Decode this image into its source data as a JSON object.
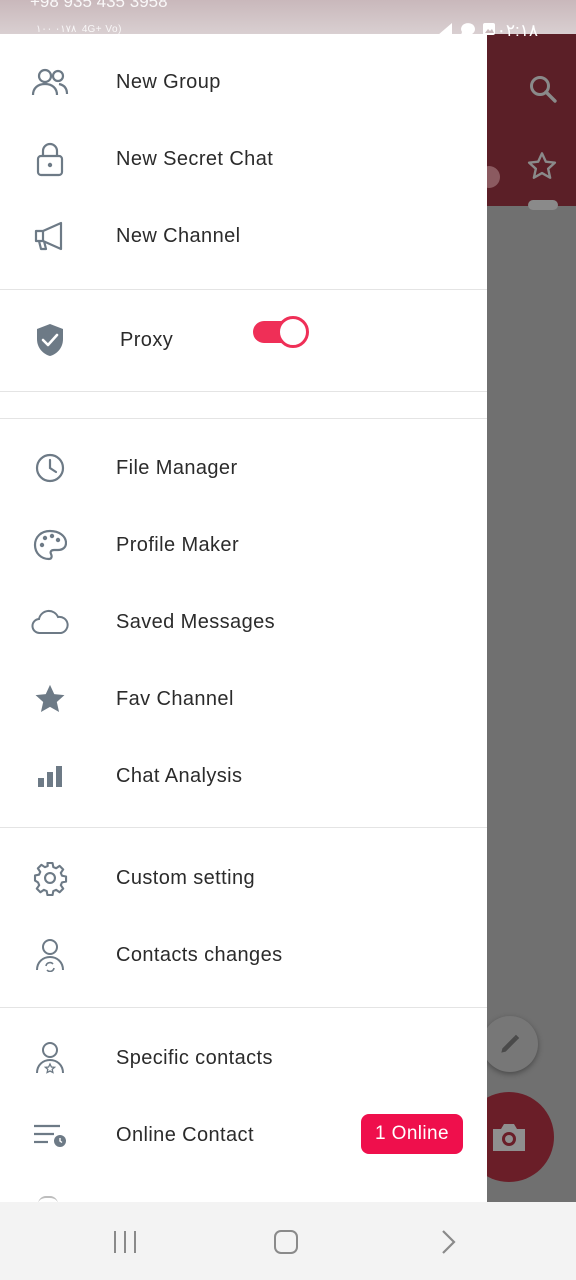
{
  "status_bar": {
    "phone": "+98 935 435 3958",
    "left_info": "۱۰۰ ۰۱۷۸ ‎ 4G+ Vo)",
    "time": "۰۲:۱۸"
  },
  "drawer": {
    "group1": [
      {
        "label": "New Group",
        "icon": "group-icon"
      },
      {
        "label": "New Secret Chat",
        "icon": "lock-icon"
      },
      {
        "label": "New Channel",
        "icon": "megaphone-icon"
      }
    ],
    "proxy": {
      "label": "Proxy",
      "icon": "shield-check-icon",
      "enabled": true
    },
    "group2": [
      {
        "label": "File Manager",
        "icon": "clock-icon"
      },
      {
        "label": "Profile Maker",
        "icon": "palette-icon"
      },
      {
        "label": "Saved Messages",
        "icon": "cloud-icon"
      },
      {
        "label": "Fav Channel",
        "icon": "star-icon"
      },
      {
        "label": "Chat Analysis",
        "icon": "bar-chart-icon"
      }
    ],
    "group3": [
      {
        "label": "Custom setting",
        "icon": "gear-icon"
      },
      {
        "label": "Contacts changes",
        "icon": "contact-sync-icon"
      }
    ],
    "group4": [
      {
        "label": "Specific contacts",
        "icon": "contact-star-icon"
      },
      {
        "label": "Online Contact",
        "icon": "list-clock-icon",
        "badge": "1 Online"
      }
    ]
  },
  "colors": {
    "accent": "#ef0f4c",
    "icon": "#6d7a86",
    "header": "#5b1f27"
  },
  "nav_bar": {
    "buttons": [
      "recents-icon",
      "home-icon",
      "back-icon"
    ]
  }
}
